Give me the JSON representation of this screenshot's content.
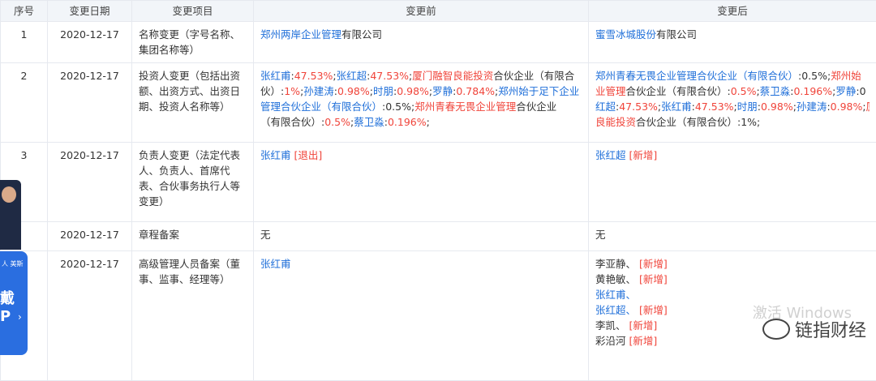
{
  "headers": [
    "序号",
    "变更日期",
    "变更项目",
    "变更前",
    "变更后"
  ],
  "rows": [
    {
      "idx": "1",
      "date": "2020-12-17",
      "item": [
        "名称变更（字号名称、",
        "集团名称等）"
      ],
      "before": [
        [
          [
            "blue",
            "郑州两岸企业管理"
          ],
          [
            "",
            "有限公司"
          ]
        ]
      ],
      "after": [
        [
          [
            "blue",
            "蜜雪冰城股份"
          ],
          [
            "",
            "有限公司"
          ]
        ]
      ]
    },
    {
      "idx": "2",
      "date": "2020-12-17",
      "item": [
        "投资人变更（包括出资",
        "额、出资方式、出资日",
        "期、投资人名称等）"
      ],
      "before": [
        [
          [
            "blue",
            "张红甫"
          ],
          [
            "",
            ":"
          ],
          [
            "red",
            "47.53%"
          ],
          [
            "",
            ";"
          ],
          [
            "blue",
            "张红超"
          ],
          [
            "",
            ":"
          ],
          [
            "red",
            "47.53%"
          ],
          [
            "",
            ";"
          ],
          [
            "red",
            "厦门融智良能投资"
          ],
          [
            "",
            "合伙企业（有限合"
          ]
        ],
        [
          [
            "",
            "伙）:"
          ],
          [
            "red",
            "1%"
          ],
          [
            "",
            ";"
          ],
          [
            "blue",
            "孙建涛"
          ],
          [
            "",
            ":"
          ],
          [
            "red",
            "0.98%"
          ],
          [
            "",
            ";"
          ],
          [
            "blue",
            "时朋"
          ],
          [
            "",
            ":"
          ],
          [
            "red",
            "0.98%"
          ],
          [
            "",
            ";"
          ],
          [
            "blue",
            "罗静"
          ],
          [
            "",
            ":"
          ],
          [
            "red",
            "0.784%"
          ],
          [
            "",
            ";"
          ],
          [
            "blue",
            "郑州始于足下企业"
          ]
        ],
        [
          [
            "blue",
            "管理合伙企业（有限合伙）"
          ],
          [
            "",
            ":0.5%;"
          ],
          [
            "red",
            "郑州青春无畏企业管理"
          ],
          [
            "",
            "合伙企业"
          ]
        ],
        [
          [
            "",
            "（有限合伙）:"
          ],
          [
            "red",
            "0.5%"
          ],
          [
            "",
            ";"
          ],
          [
            "blue",
            "蔡卫淼"
          ],
          [
            "",
            ":"
          ],
          [
            "red",
            "0.196%"
          ],
          [
            "",
            ";"
          ]
        ]
      ],
      "after": [
        [
          [
            "blue",
            "郑州青春无畏企业管理合伙企业（有限合伙）"
          ],
          [
            "",
            ":0.5%;"
          ],
          [
            "red",
            "郑州始"
          ]
        ],
        [
          [
            "red",
            "业管理"
          ],
          [
            "",
            "合伙企业（有限合伙）:"
          ],
          [
            "red",
            "0.5%"
          ],
          [
            "",
            ";"
          ],
          [
            "blue",
            "蔡卫淼"
          ],
          [
            "",
            ":"
          ],
          [
            "red",
            "0.196%"
          ],
          [
            "",
            ";"
          ],
          [
            "blue",
            "罗静"
          ],
          [
            "",
            ":0"
          ]
        ],
        [
          [
            "blue",
            "红超"
          ],
          [
            "",
            ":"
          ],
          [
            "red",
            "47.53%"
          ],
          [
            "",
            ";"
          ],
          [
            "blue",
            "张红甫"
          ],
          [
            "",
            ":"
          ],
          [
            "red",
            "47.53%"
          ],
          [
            "",
            ";"
          ],
          [
            "blue",
            "时朋"
          ],
          [
            "",
            ":"
          ],
          [
            "red",
            "0.98%"
          ],
          [
            "",
            ";"
          ],
          [
            "blue",
            "孙建涛"
          ],
          [
            "",
            ":"
          ],
          [
            "red",
            "0.98%"
          ],
          [
            "",
            ";"
          ],
          [
            "red",
            "厦"
          ]
        ],
        [
          [
            "red",
            "良能投资"
          ],
          [
            "",
            "合伙企业（有限合伙）:1%;"
          ]
        ]
      ]
    },
    {
      "idx": "3",
      "date": "2020-12-17",
      "item": [
        "负责人变更（法定代表",
        "人、负责人、首席代",
        "表、合伙事务执行人等",
        "变更）"
      ],
      "before": [
        [
          [
            "blue",
            "张红甫"
          ],
          [
            "",
            " "
          ],
          [
            "red",
            "[退出]"
          ]
        ]
      ],
      "after": [
        [
          [
            "blue",
            "张红超"
          ],
          [
            "",
            " "
          ],
          [
            "red",
            "[新增]"
          ]
        ]
      ]
    },
    {
      "idx": "",
      "date": "2020-12-17",
      "item": [
        "章程备案"
      ],
      "before": [
        [
          [
            "",
            "无"
          ]
        ]
      ],
      "after": [
        [
          [
            "",
            "无"
          ]
        ]
      ]
    },
    {
      "idx": "5",
      "date": "2020-12-17",
      "item": [
        "高级管理人员备案（董",
        "事、监事、经理等）"
      ],
      "before": [
        [
          [
            "blue",
            "张红甫"
          ]
        ]
      ],
      "after": [
        [
          [
            "",
            "李亚静、"
          ],
          [
            "",
            " "
          ],
          [
            "red",
            "[新增]"
          ]
        ],
        [
          [
            "",
            "黄艳敏、"
          ],
          [
            "",
            " "
          ],
          [
            "red",
            "[新增]"
          ]
        ],
        [
          [
            "blue",
            "张红甫、"
          ]
        ],
        [
          [
            "blue",
            "张红超、"
          ],
          [
            "",
            " "
          ],
          [
            "red",
            "[新增]"
          ]
        ],
        [
          [
            "",
            "李凯、"
          ],
          [
            "",
            " "
          ],
          [
            "red",
            "[新增]"
          ]
        ],
        [
          [
            "",
            "彩沿河"
          ],
          [
            "",
            " "
          ],
          [
            "red",
            "[新增]"
          ]
        ]
      ]
    }
  ],
  "ad": {
    "line1": "人 美斯",
    "line2": "戴",
    "line3": "P",
    "arrow": "›"
  },
  "watermark": {
    "faint": "激活 Windows",
    "brand": "链指财经",
    "faint2": "Win"
  }
}
